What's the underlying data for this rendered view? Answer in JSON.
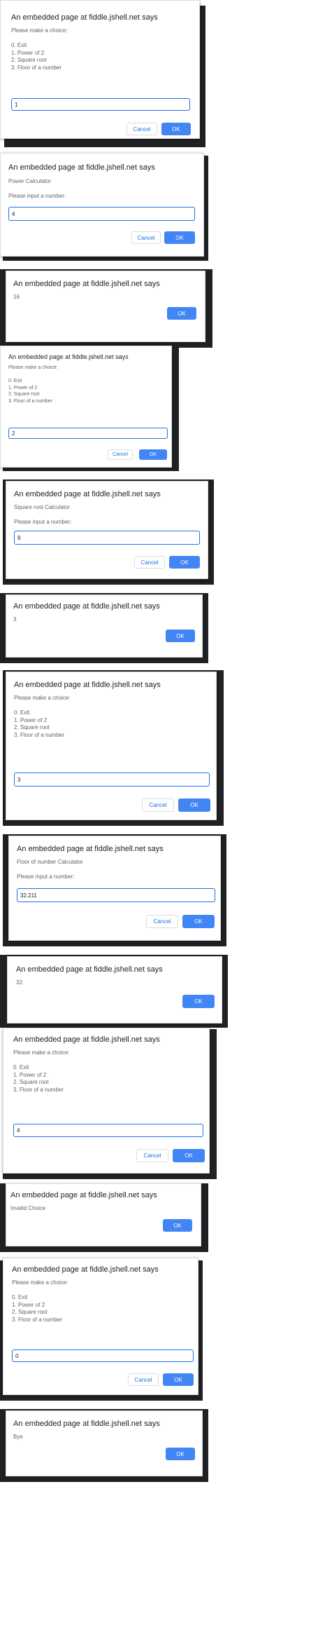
{
  "common": {
    "dialog_title": "An embedded page at fiddle.jshell.net says",
    "cancel_label": "Cancel",
    "ok_label": "OK",
    "menu_text": "Please make a choice:\n\n0. Exit\n1. Power of 2\n2. Square root\n3. Floor of a number"
  },
  "screens": [
    {
      "type": "prompt",
      "message": "Please make a choice:\n\n0. Exit\n1. Power of 2\n2. Square root\n3. Floor of a number",
      "input_value": "1"
    },
    {
      "type": "prompt",
      "message": "Power Calculator\n\nPlease input a number:",
      "input_value": "4"
    },
    {
      "type": "alert",
      "message": "16"
    },
    {
      "type": "prompt",
      "message": "Please make a choice:\n\n0. Exit\n1. Power of 2\n2. Square root\n3. Floor of a number",
      "input_value": "2"
    },
    {
      "type": "prompt",
      "message": "Square root Calculator\n\nPlease input a number:",
      "input_value": "9"
    },
    {
      "type": "alert",
      "message": "3"
    },
    {
      "type": "prompt",
      "message": "Please make a choice:\n\n0. Exit\n1. Power of 2\n2. Square root\n3. Floor of a number",
      "input_value": "3"
    },
    {
      "type": "prompt",
      "message": "Floor of number Calculator\n\nPlease input a number:",
      "input_value": "32.211"
    },
    {
      "type": "alert",
      "message": "32"
    },
    {
      "type": "prompt",
      "message": "Please make a choice:\n\n0. Exit\n1. Power of 2\n2. Square root\n3. Floor of a number",
      "input_value": "4"
    },
    {
      "type": "alert",
      "message": "Invalid Choice"
    },
    {
      "type": "prompt",
      "message": "Please make a choice:\n\n0. Exit\n1. Power of 2\n2. Square root\n3. Floor of a number",
      "input_value": "0"
    },
    {
      "type": "alert",
      "message": "Bye"
    }
  ]
}
